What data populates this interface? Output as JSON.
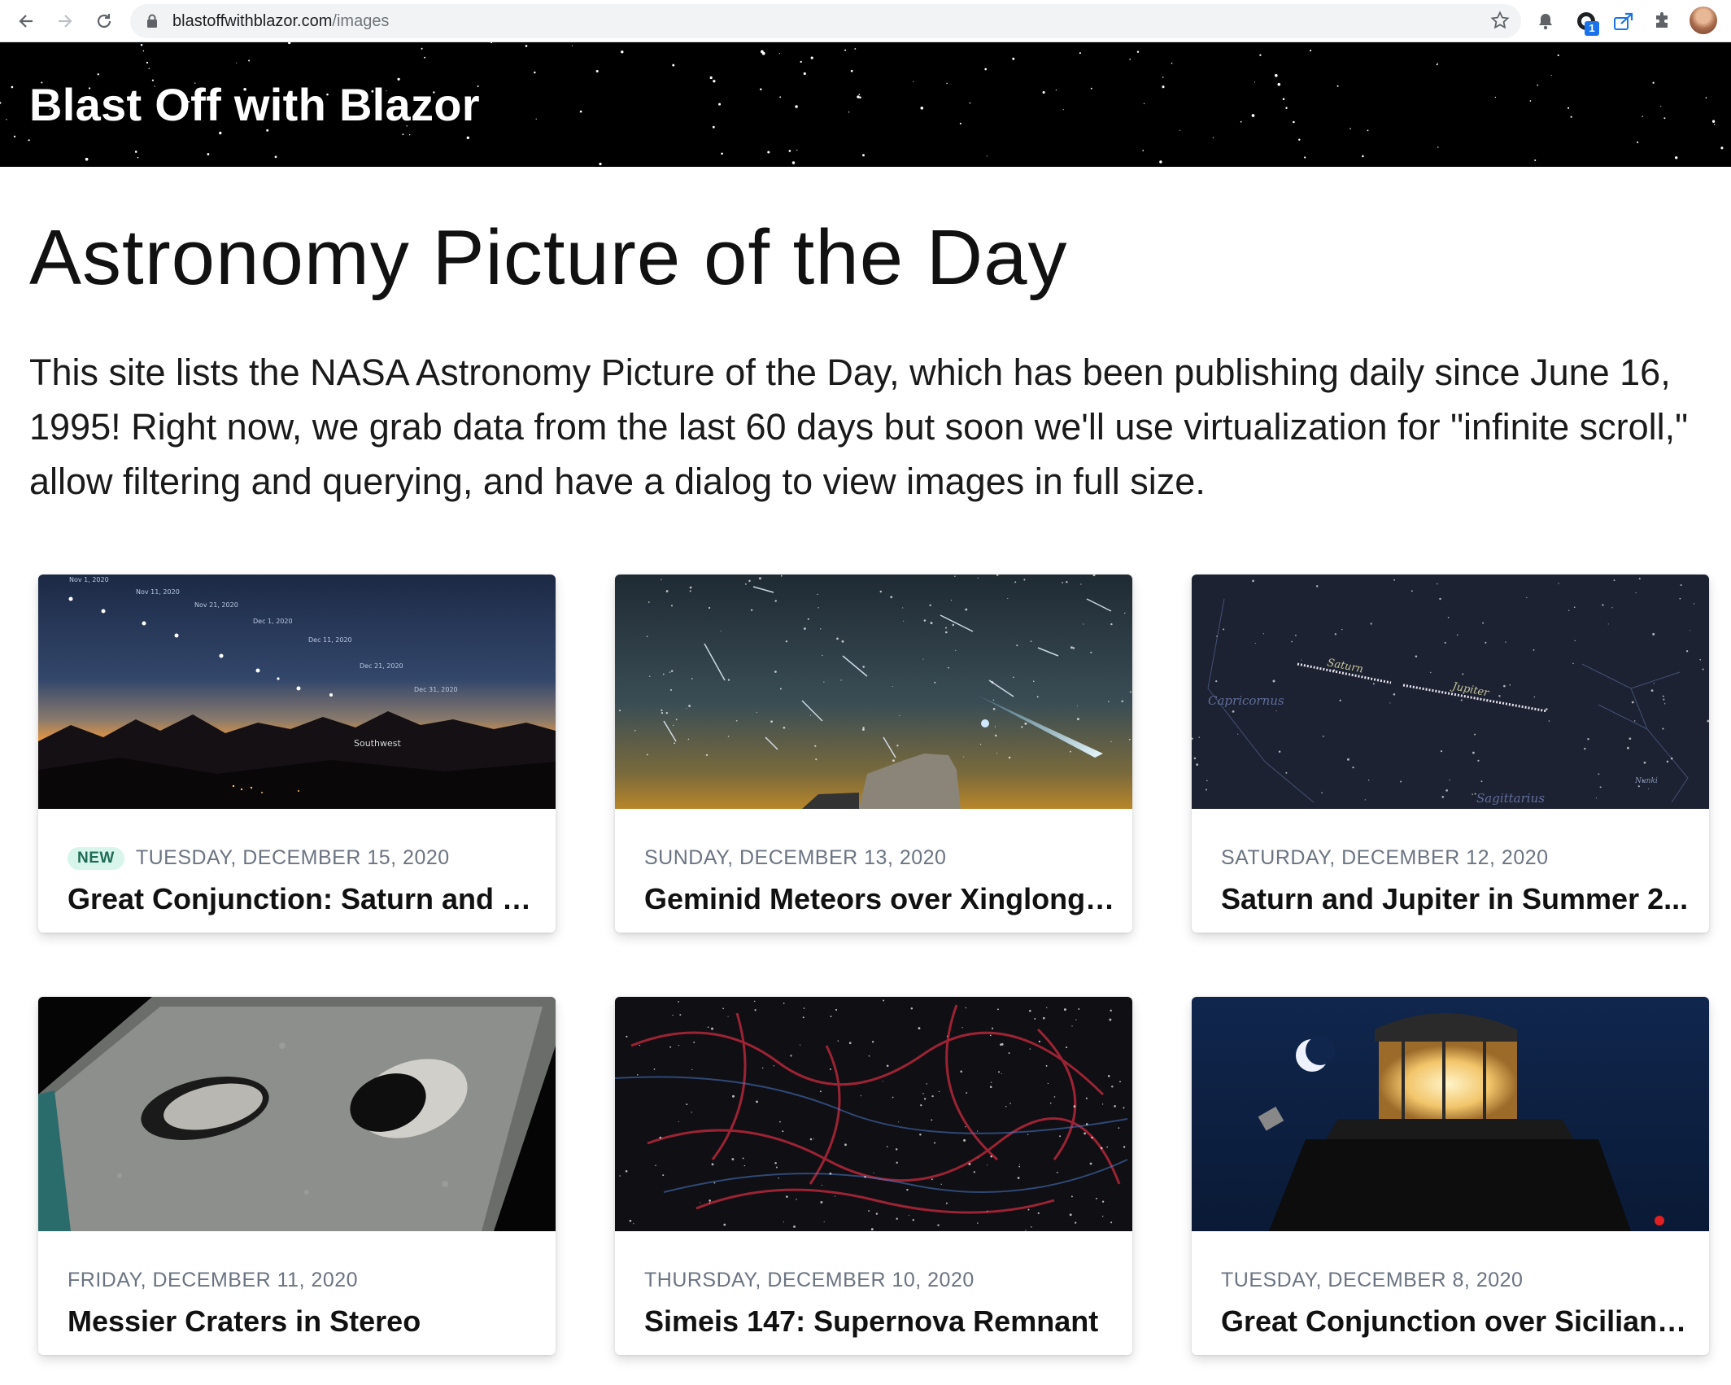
{
  "browser": {
    "url_domain": "blastoffwithblazor.com",
    "url_path": "/images",
    "extension_badge": "1"
  },
  "site": {
    "title": "Blast Off with Blazor"
  },
  "main": {
    "heading": "Astronomy Picture of the Day",
    "intro": "This site lists the NASA Astronomy Picture of the Day, which has been publishing daily since June 16, 1995! Right now, we grab data from the last 60 days but soon we'll use virtualization for \"infinite scroll,\" allow filtering and querying, and have a dialog to view images in full size."
  },
  "cards": [
    {
      "badge": "NEW",
      "date": "TUESDAY, DECEMBER 15, 2020",
      "title": "Great Conjunction: Saturn and J...",
      "image": "sunset-mountains-planets",
      "image_labels": [
        "Nov 1, 2020",
        "Nov 11, 2020",
        "Nov 21, 2020",
        "Dec 1, 2020",
        "Dec 11, 2020",
        "Dec 21, 2020",
        "Dec 31, 2020",
        "Southwest"
      ]
    },
    {
      "date": "SUNDAY, DECEMBER 13, 2020",
      "title": "Geminid Meteors over Xinglong ...",
      "image": "meteor-shower-observatory"
    },
    {
      "date": "SATURDAY, DECEMBER 12, 2020",
      "title": "Saturn and Jupiter in Summer 2...",
      "image": "planet-trails-constellations",
      "image_labels": [
        "Saturn",
        "Jupiter",
        "Capricornus",
        "Sagittarius",
        "Nunki"
      ]
    },
    {
      "date": "FRIDAY, DECEMBER 11, 2020",
      "title": "Messier Craters in Stereo",
      "image": "moon-craters-anaglyph"
    },
    {
      "date": "THURSDAY, DECEMBER 10, 2020",
      "title": "Simeis 147: Supernova Remnant",
      "image": "red-nebula-filaments"
    },
    {
      "date": "TUESDAY, DECEMBER 8, 2020",
      "title": "Great Conjunction over Sicilian L...",
      "image": "lighthouse-moon-night"
    }
  ]
}
